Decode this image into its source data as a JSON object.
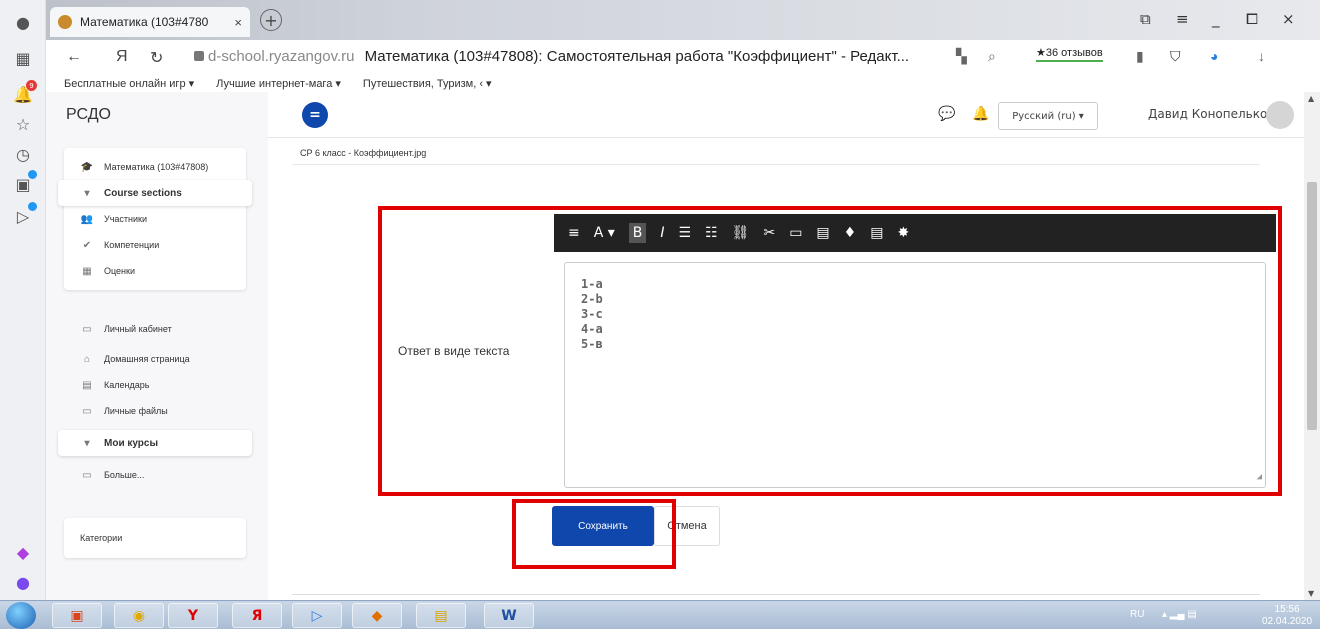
{
  "browser": {
    "tab_title": "Математика (103#4780",
    "tab_close": "×",
    "new_tab": "+",
    "win_controls": [
      "⧉",
      "≡",
      "_",
      "⧠",
      "×"
    ],
    "nav_back": "←",
    "logo": "Я",
    "nav_reload": "↻",
    "url_domain": "d-school.ryazangov.ru",
    "page_title": "Математика (103#47808): Самостоятельная работа \"Коэффициент\" - Редакт...",
    "reviews": "★36 отзывов",
    "bookmarks": [
      "Бесплатные онлайн игр ▾",
      "Лучшие интернет-мага ▾",
      "Путешествия, Туризм, ‹ ▾"
    ],
    "notif_badge": "9"
  },
  "site": {
    "title": "РСДО",
    "language": "Русский (ru) ▾",
    "user_name": "Давид Конопелько"
  },
  "drawer": {
    "course_items": [
      {
        "icon": "🎓",
        "label": "Математика (103#47808)"
      },
      {
        "icon": "▾",
        "label": "Course sections"
      },
      {
        "icon": "👥",
        "label": "Участники"
      },
      {
        "icon": "✔",
        "label": "Компетенции"
      },
      {
        "icon": "▦",
        "label": "Оценки"
      }
    ],
    "nav_items": [
      {
        "icon": "▭",
        "label": "Личный кабинет"
      },
      {
        "icon": "⌂",
        "label": "Домашняя страница"
      },
      {
        "icon": "▤",
        "label": "Календарь"
      },
      {
        "icon": "▭",
        "label": "Личные файлы"
      },
      {
        "icon": "▾",
        "label": "Мои курсы"
      },
      {
        "icon": "▭",
        "label": "Больше..."
      }
    ],
    "categories": "Категории"
  },
  "main": {
    "filename": "СР 6 класс - Коэффициент.jpg",
    "answer_label": "Ответ в виде текста",
    "answer_lines": [
      "1-а",
      "2-b",
      "3-с",
      "4-a",
      "5-в"
    ],
    "save_label": "Сохранить",
    "cancel_label": "Отмена"
  },
  "toolbar_icons": [
    "≡",
    "A ▾",
    "B",
    "I",
    "☰",
    "☷",
    "⛓",
    "✂",
    "▭",
    "▤",
    "♦",
    "▤",
    "✸"
  ],
  "taskbar": {
    "lang": "RU",
    "time": "15:56",
    "date": "02.04.2020"
  }
}
